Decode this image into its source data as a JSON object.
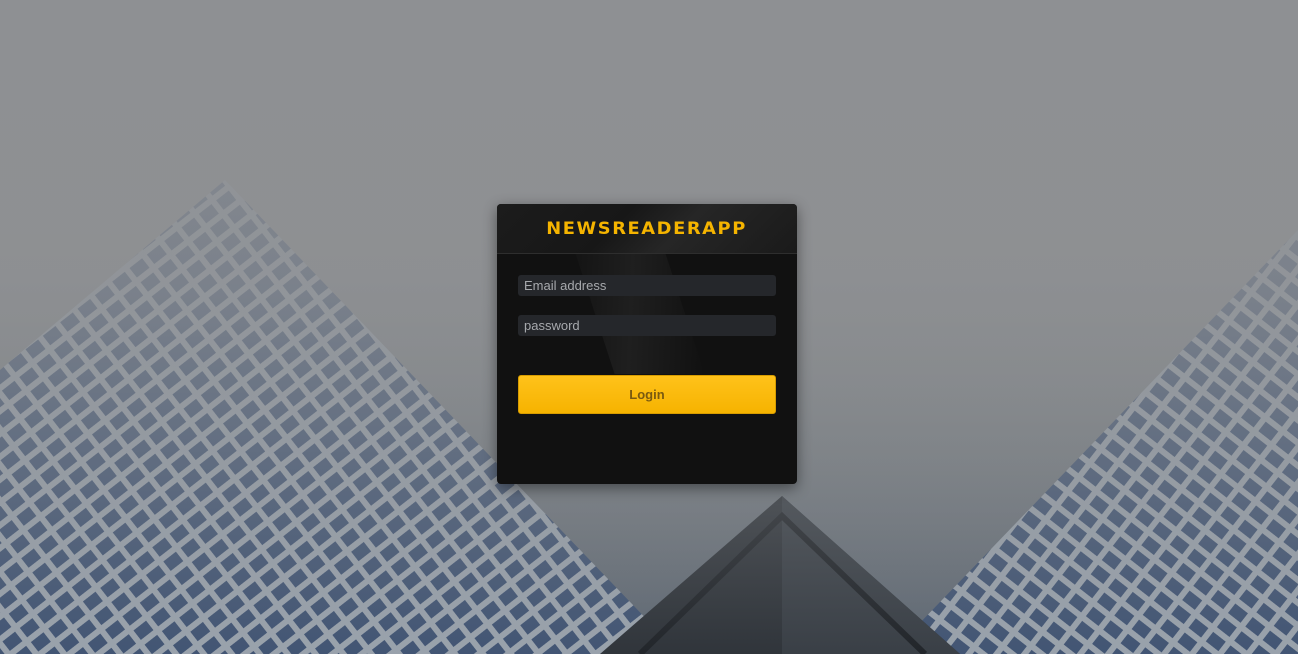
{
  "app": {
    "brand": "NEWSREADERAPP"
  },
  "login_form": {
    "email_placeholder": "Email address",
    "email_value": "",
    "password_placeholder": "password",
    "password_value": "",
    "submit_label": "Login"
  },
  "colors": {
    "accent": "#f5b400",
    "card_background": "#111111",
    "input_background": "#25272b"
  }
}
